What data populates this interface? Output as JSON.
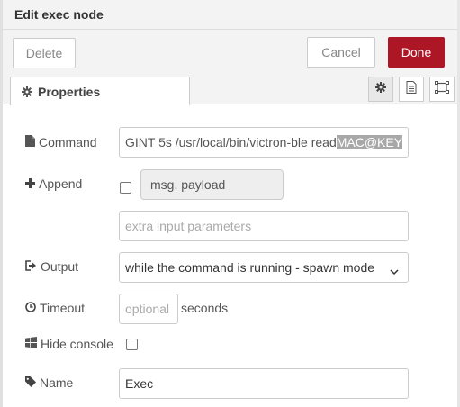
{
  "window": {
    "title": "Edit exec node"
  },
  "toolbar": {
    "delete_label": "Delete",
    "cancel_label": "Cancel",
    "done_label": "Done",
    "done_color": "#ad1625"
  },
  "tabs": {
    "properties_label": "Properties"
  },
  "form": {
    "command": {
      "label": "Command",
      "value_prefix": "GINT 5s /usr/local/bin/victron-ble read ",
      "value_selected": "MAC@KEY"
    },
    "append": {
      "label": "Append",
      "checked": false,
      "field_value": "msg. payload",
      "extra_placeholder": "extra input parameters"
    },
    "output": {
      "label": "Output",
      "selected": "while the command is running - spawn mode"
    },
    "timeout": {
      "label": "Timeout",
      "placeholder": "optional",
      "unit": "seconds"
    },
    "hide_console": {
      "label": "Hide console",
      "checked": false
    },
    "name": {
      "label": "Name",
      "value": "Exec"
    }
  },
  "icons": [
    "cog-icon",
    "file-icon",
    "plus-icon",
    "sign-out-icon",
    "clock-icon",
    "windows-icon",
    "tag-icon",
    "document-icon",
    "frame-icon",
    "caret-down-icon"
  ]
}
